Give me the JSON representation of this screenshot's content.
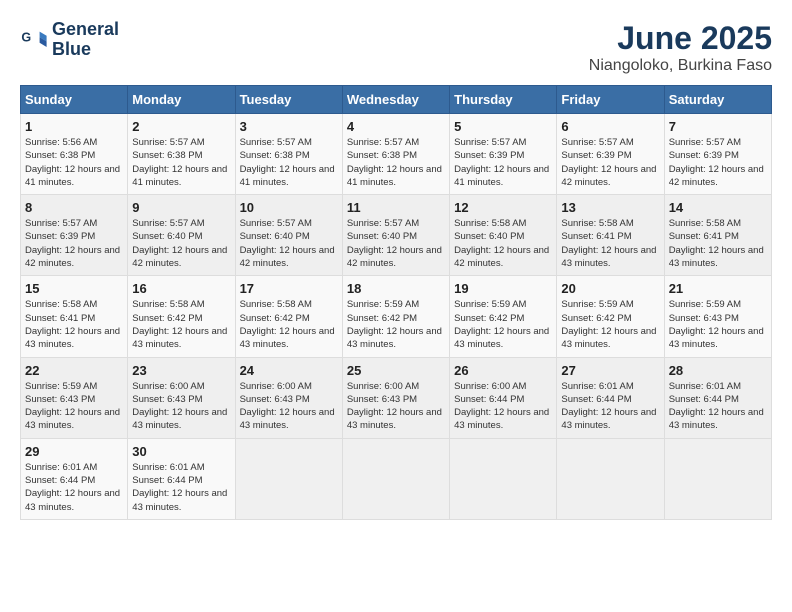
{
  "logo": {
    "line1": "General",
    "line2": "Blue"
  },
  "title": "June 2025",
  "subtitle": "Niangoloko, Burkina Faso",
  "weekdays": [
    "Sunday",
    "Monday",
    "Tuesday",
    "Wednesday",
    "Thursday",
    "Friday",
    "Saturday"
  ],
  "weeks": [
    [
      {
        "day": 1,
        "sunrise": "5:56 AM",
        "sunset": "6:38 PM",
        "daylight": "12 hours and 41 minutes."
      },
      {
        "day": 2,
        "sunrise": "5:57 AM",
        "sunset": "6:38 PM",
        "daylight": "12 hours and 41 minutes."
      },
      {
        "day": 3,
        "sunrise": "5:57 AM",
        "sunset": "6:38 PM",
        "daylight": "12 hours and 41 minutes."
      },
      {
        "day": 4,
        "sunrise": "5:57 AM",
        "sunset": "6:38 PM",
        "daylight": "12 hours and 41 minutes."
      },
      {
        "day": 5,
        "sunrise": "5:57 AM",
        "sunset": "6:39 PM",
        "daylight": "12 hours and 41 minutes."
      },
      {
        "day": 6,
        "sunrise": "5:57 AM",
        "sunset": "6:39 PM",
        "daylight": "12 hours and 42 minutes."
      },
      {
        "day": 7,
        "sunrise": "5:57 AM",
        "sunset": "6:39 PM",
        "daylight": "12 hours and 42 minutes."
      }
    ],
    [
      {
        "day": 8,
        "sunrise": "5:57 AM",
        "sunset": "6:39 PM",
        "daylight": "12 hours and 42 minutes."
      },
      {
        "day": 9,
        "sunrise": "5:57 AM",
        "sunset": "6:40 PM",
        "daylight": "12 hours and 42 minutes."
      },
      {
        "day": 10,
        "sunrise": "5:57 AM",
        "sunset": "6:40 PM",
        "daylight": "12 hours and 42 minutes."
      },
      {
        "day": 11,
        "sunrise": "5:57 AM",
        "sunset": "6:40 PM",
        "daylight": "12 hours and 42 minutes."
      },
      {
        "day": 12,
        "sunrise": "5:58 AM",
        "sunset": "6:40 PM",
        "daylight": "12 hours and 42 minutes."
      },
      {
        "day": 13,
        "sunrise": "5:58 AM",
        "sunset": "6:41 PM",
        "daylight": "12 hours and 43 minutes."
      },
      {
        "day": 14,
        "sunrise": "5:58 AM",
        "sunset": "6:41 PM",
        "daylight": "12 hours and 43 minutes."
      }
    ],
    [
      {
        "day": 15,
        "sunrise": "5:58 AM",
        "sunset": "6:41 PM",
        "daylight": "12 hours and 43 minutes."
      },
      {
        "day": 16,
        "sunrise": "5:58 AM",
        "sunset": "6:42 PM",
        "daylight": "12 hours and 43 minutes."
      },
      {
        "day": 17,
        "sunrise": "5:58 AM",
        "sunset": "6:42 PM",
        "daylight": "12 hours and 43 minutes."
      },
      {
        "day": 18,
        "sunrise": "5:59 AM",
        "sunset": "6:42 PM",
        "daylight": "12 hours and 43 minutes."
      },
      {
        "day": 19,
        "sunrise": "5:59 AM",
        "sunset": "6:42 PM",
        "daylight": "12 hours and 43 minutes."
      },
      {
        "day": 20,
        "sunrise": "5:59 AM",
        "sunset": "6:42 PM",
        "daylight": "12 hours and 43 minutes."
      },
      {
        "day": 21,
        "sunrise": "5:59 AM",
        "sunset": "6:43 PM",
        "daylight": "12 hours and 43 minutes."
      }
    ],
    [
      {
        "day": 22,
        "sunrise": "5:59 AM",
        "sunset": "6:43 PM",
        "daylight": "12 hours and 43 minutes."
      },
      {
        "day": 23,
        "sunrise": "6:00 AM",
        "sunset": "6:43 PM",
        "daylight": "12 hours and 43 minutes."
      },
      {
        "day": 24,
        "sunrise": "6:00 AM",
        "sunset": "6:43 PM",
        "daylight": "12 hours and 43 minutes."
      },
      {
        "day": 25,
        "sunrise": "6:00 AM",
        "sunset": "6:43 PM",
        "daylight": "12 hours and 43 minutes."
      },
      {
        "day": 26,
        "sunrise": "6:00 AM",
        "sunset": "6:44 PM",
        "daylight": "12 hours and 43 minutes."
      },
      {
        "day": 27,
        "sunrise": "6:01 AM",
        "sunset": "6:44 PM",
        "daylight": "12 hours and 43 minutes."
      },
      {
        "day": 28,
        "sunrise": "6:01 AM",
        "sunset": "6:44 PM",
        "daylight": "12 hours and 43 minutes."
      }
    ],
    [
      {
        "day": 29,
        "sunrise": "6:01 AM",
        "sunset": "6:44 PM",
        "daylight": "12 hours and 43 minutes."
      },
      {
        "day": 30,
        "sunrise": "6:01 AM",
        "sunset": "6:44 PM",
        "daylight": "12 hours and 43 minutes."
      },
      null,
      null,
      null,
      null,
      null
    ]
  ]
}
